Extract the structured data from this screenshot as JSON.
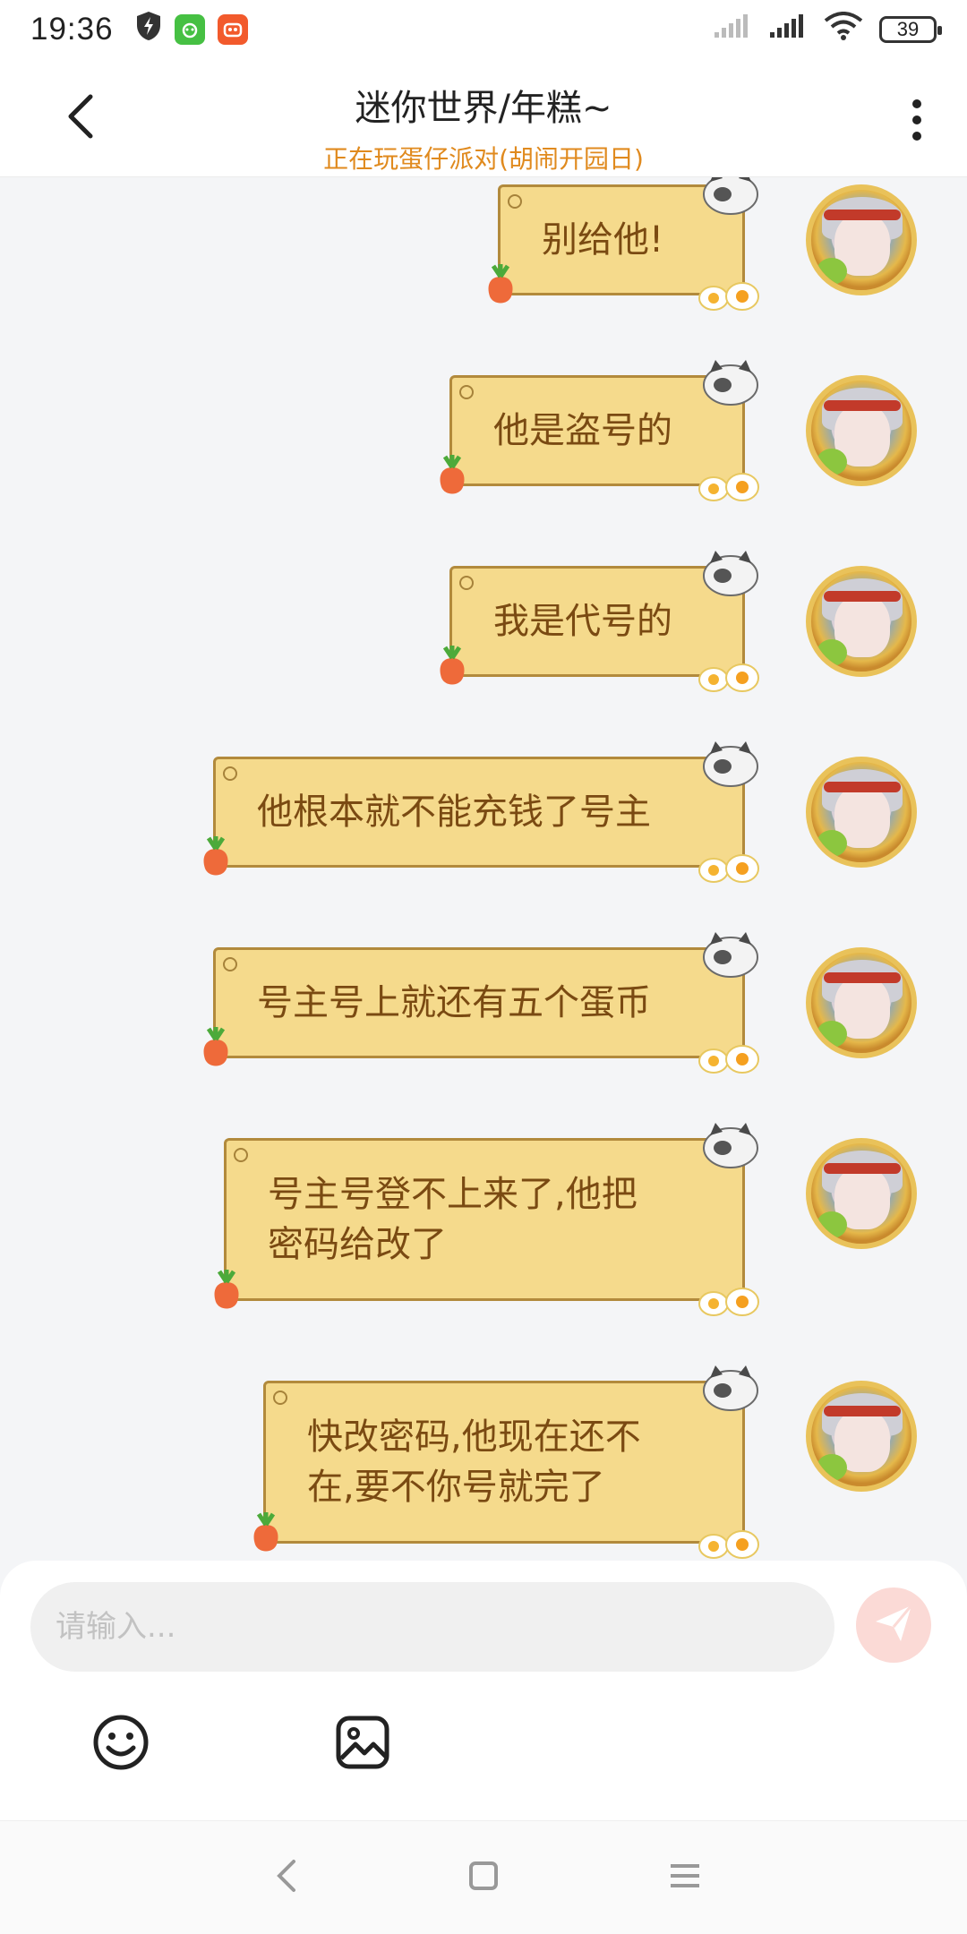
{
  "status_bar": {
    "time": "19:36",
    "battery": "39",
    "app_icons": [
      "shield-bolt-icon",
      "green-app-icon",
      "orange-app-icon"
    ]
  },
  "header": {
    "title": "迷你世界/年糕~",
    "subtitle": "正在玩蛋仔派对(胡闹开园日)",
    "back_icon": "chevron-left-icon",
    "more_icon": "vertical-dots-icon"
  },
  "messages": [
    {
      "text": "别给他!"
    },
    {
      "text": "他是盗号的"
    },
    {
      "text": "我是代号的"
    },
    {
      "text": "他根本就不能充钱了号主"
    },
    {
      "text": "号主号上就还有五个蛋币"
    },
    {
      "text": "号主号登不上来了,他把\n密码给改了"
    },
    {
      "text": "快改密码,他现在还不\n在,要不你号就完了"
    }
  ],
  "input": {
    "placeholder": "请输入..."
  },
  "toolbar": {
    "emoji_icon": "emoji-icon",
    "image_icon": "image-icon",
    "send_icon": "send-icon"
  },
  "nav": [
    "back-nav-icon",
    "home-nav-icon",
    "menu-nav-icon"
  ],
  "colors": {
    "accent": "#e08a1e",
    "bubble": "#f5da8c",
    "bubble_text": "#7a4a12",
    "send_button": "#fbdad6"
  }
}
